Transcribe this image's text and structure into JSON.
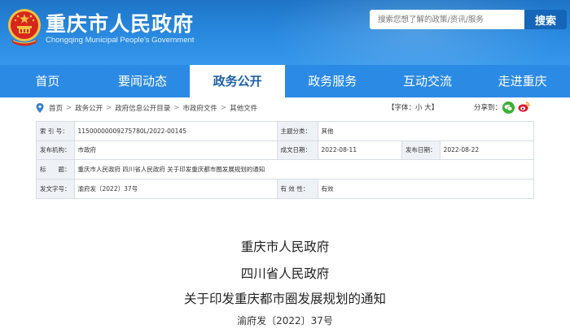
{
  "header": {
    "title": "重庆市人民政府",
    "subtitle": "Chongqing Municipal People's Government",
    "search_placeholder": "搜索您想了解的政策/资讯/服务",
    "search_button": "搜索"
  },
  "nav": {
    "items": [
      "首页",
      "要闻动态",
      "政务公开",
      "政务服务",
      "互动交流",
      "走进重庆"
    ],
    "active_index": 2
  },
  "breadcrumb": {
    "items": [
      "首页",
      "政务公开",
      "政府信息公开目录",
      "市政府文件",
      "其他文件"
    ],
    "separator": ">"
  },
  "font_size": "【字体：小 大】",
  "share_label": "分享到：",
  "info": {
    "index_label": "索 引 号：",
    "index_value": "11500000009275780L/2022-00145",
    "topic_label": "主题分类：",
    "topic_value": "其他",
    "issuer_label": "发布机构：",
    "issuer_value": "市政府",
    "created_label": "成文日期：",
    "created_value": "2022-08-11",
    "published_label": "发布日期：",
    "published_value": "2022-08-22",
    "title_label": "标　　题：",
    "title_value": "重庆市人民政府 四川省人民政府 关于印发重庆都市圈发展规划的通知",
    "docno_label": "发文字号：",
    "docno_value": "渝府发〔2022〕37号",
    "validity_label": "有 效 性：",
    "validity_value": "有效"
  },
  "document": {
    "line1": "重庆市人民政府",
    "line2": "四川省人民政府",
    "line3": "关于印发重庆都市圈发展规划的通知",
    "line4": "渝府发〔2022〕37号"
  },
  "colors": {
    "header_blue": "#2a8ae0",
    "nav_blue": "#2b8ae4",
    "search_button": "#1566b8",
    "emblem_red": "#d7261d",
    "emblem_gold": "#f3c242"
  }
}
